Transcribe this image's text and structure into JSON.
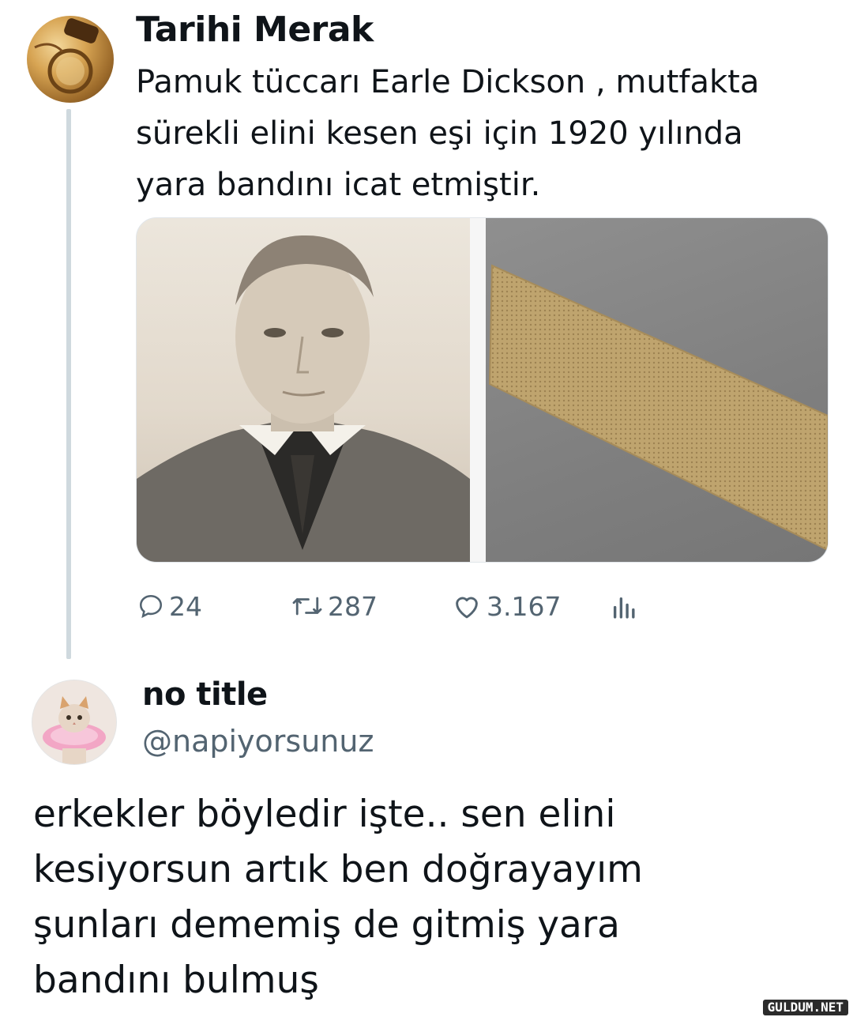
{
  "tweet": {
    "author_name": "Tarihi Merak",
    "text": "Pamuk tüccarı Earle Dickson , mutfakta\nsürekli elini kesen eşi için 1920 yılında\nyara bandını icat etmiştir.",
    "media": [
      "portrait-photo",
      "bandage-photo"
    ],
    "stats": {
      "replies": "24",
      "retweets": "287",
      "likes": "3.167"
    }
  },
  "reply": {
    "author_name": "no title",
    "handle": "@napiyorsunuz",
    "text": "erkekler böyledir işte.. sen elini\nkesiyorsun artık ben doğrayayım\nşunları dememiş de gitmiş yara\nbandını bulmuş"
  },
  "watermark": "GULDUM.NET",
  "icons": [
    "reply-icon",
    "retweet-icon",
    "like-icon",
    "views-icon"
  ],
  "colors": {
    "text": "#0f1419",
    "muted": "#536471",
    "thread_line": "#cfd9de"
  }
}
